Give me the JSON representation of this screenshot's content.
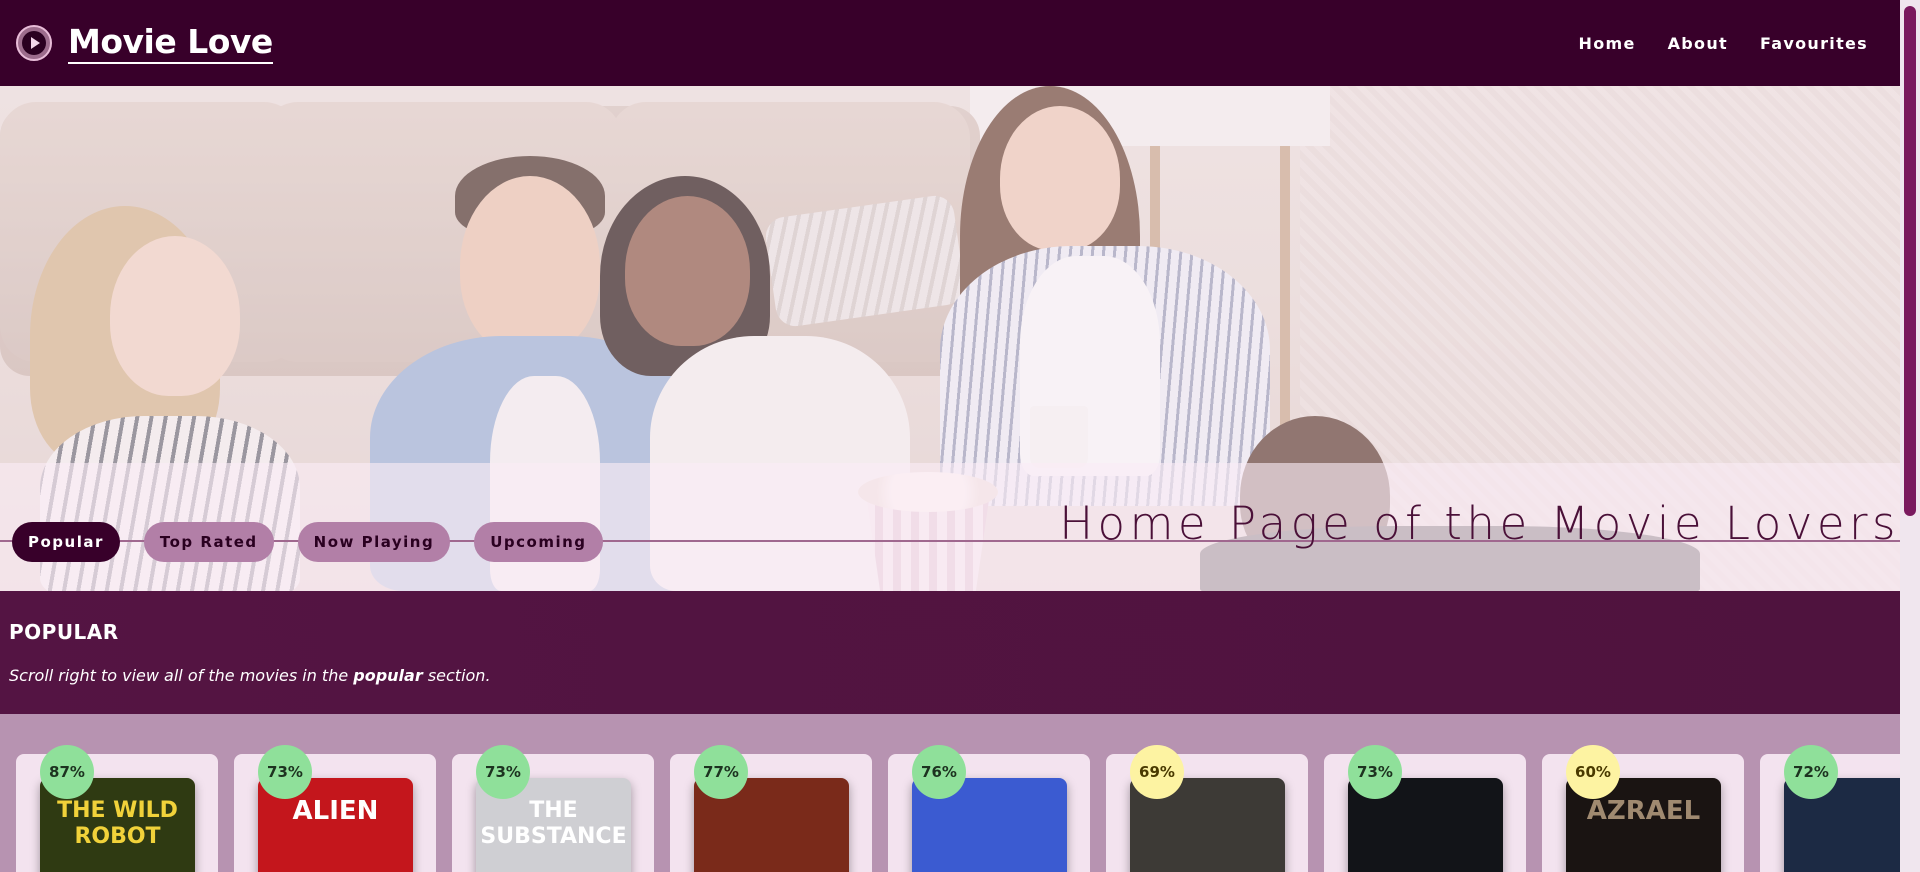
{
  "header": {
    "logo_text": "Movie Love",
    "nav": [
      "Home",
      "About",
      "Favourites"
    ]
  },
  "hero": {
    "title": "Home Page of the Movie Lovers",
    "filters": [
      "Popular",
      "Top Rated",
      "Now Playing",
      "Upcoming"
    ],
    "active_filter": "Popular"
  },
  "section": {
    "title": "POPULAR",
    "desc_prefix": "Scroll right to view all of the movies in the ",
    "desc_bold": "popular",
    "desc_suffix": " section."
  },
  "movies": [
    {
      "rating": "87%",
      "poster_text": "THE WILD ROBOT",
      "tier": "high",
      "bg": "#2f3a12",
      "fg": "#f1d23a"
    },
    {
      "rating": "73%",
      "poster_text": "ALIEN",
      "tier": "high",
      "bg": "#c4161c",
      "fg": "#ffffff"
    },
    {
      "rating": "73%",
      "poster_text": "THE SUBSTANCE",
      "tier": "high",
      "bg": "#cfcfd3",
      "fg": "#ffffff"
    },
    {
      "rating": "77%",
      "poster_text": "",
      "tier": "high",
      "bg": "#7a2a1a",
      "fg": "#ffffff"
    },
    {
      "rating": "76%",
      "poster_text": "",
      "tier": "high",
      "bg": "#3b5bd1",
      "fg": "#ffffff"
    },
    {
      "rating": "69%",
      "poster_text": "",
      "tier": "mid",
      "bg": "#3d3a36",
      "fg": "#ffffff"
    },
    {
      "rating": "73%",
      "poster_text": "",
      "tier": "high",
      "bg": "#121418",
      "fg": "#ffffff"
    },
    {
      "rating": "60%",
      "poster_text": "AZRAEL",
      "tier": "mid",
      "bg": "#1a1412",
      "fg": "#a08a70"
    },
    {
      "rating": "72%",
      "poster_text": "",
      "tier": "high",
      "bg": "#1c2a44",
      "fg": "#ffffff"
    }
  ],
  "colors": {
    "header_bg": "#38002a",
    "accent": "#b27fa7",
    "active_tab": "#38002a",
    "rating_high": "#8fe09a",
    "rating_mid": "#fdf3a2"
  }
}
